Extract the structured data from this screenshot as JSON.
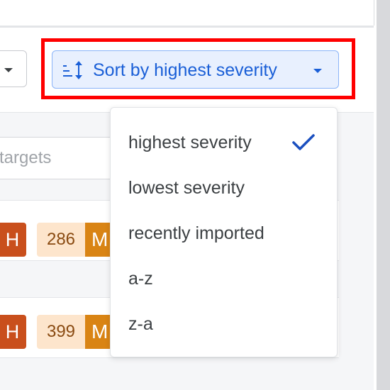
{
  "toolbar": {
    "sort_button": {
      "label": "Sort by highest severity",
      "icon": "sort-icon",
      "caret_icon": "chevron-down-icon",
      "accent_color": "#1a5fd7",
      "background_color": "#e8f0fe"
    },
    "left_select": {
      "caret_icon": "chevron-down-icon"
    },
    "highlight_color": "#ff0000"
  },
  "search": {
    "placeholder": "targets"
  },
  "rows": [
    {
      "high_label": "H",
      "count": "286",
      "medium_label": "M"
    },
    {
      "high_label": "H",
      "count": "399",
      "medium_label": "M"
    }
  ],
  "sort_menu": {
    "selected_index": 0,
    "check_icon": "checkmark-icon",
    "options": [
      {
        "label": "highest severity"
      },
      {
        "label": "lowest severity"
      },
      {
        "label": "recently imported"
      },
      {
        "label": "a-z"
      },
      {
        "label": "z-a"
      }
    ]
  },
  "colors": {
    "high_tag": "#c94f1c",
    "medium_tag": "#d98414",
    "count_tag_bg": "#fde5cc"
  }
}
